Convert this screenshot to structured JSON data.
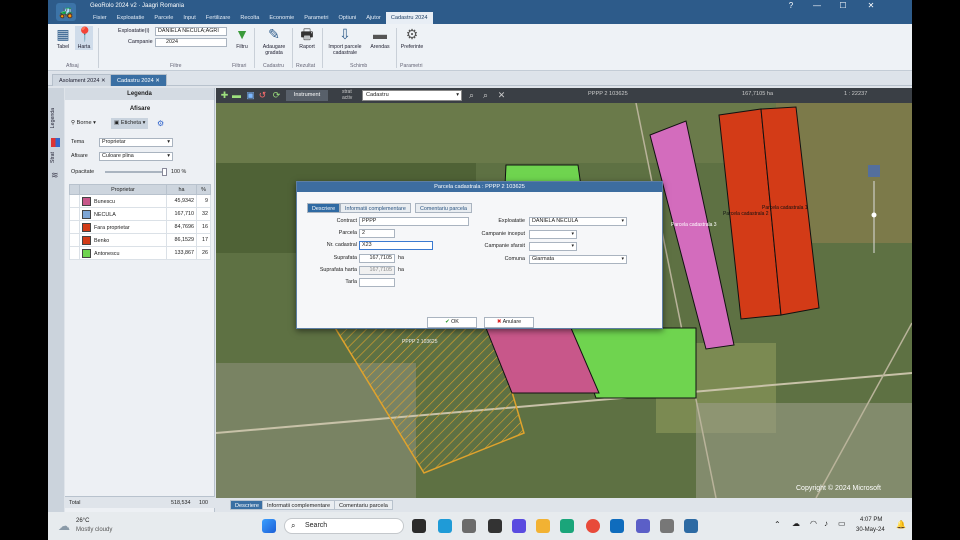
{
  "app": {
    "title": "GeoRolo 2024 v2 · Jaagri Romania",
    "menu": [
      "Fisier",
      "Exploatatie",
      "Parcele",
      "Input",
      "Fertilizare",
      "Recolta",
      "Economie",
      "Parametri",
      "Optiuni",
      "Ajutor",
      "Cadastru 2024"
    ],
    "window_controls": {
      "help": "?",
      "min": "—",
      "max": "☐",
      "close": "✕"
    }
  },
  "ribbon": {
    "tabel_label": "Tabel",
    "harta_label": "Harta",
    "afisaj_label": "Afisaj",
    "exploatatie_label": "Exploatatie(i)",
    "exploatatie_value": "DANIELA NECULA;AGRI",
    "campanie_label": "Campanie",
    "campanie_value": "2024",
    "filtre_label": "Filtre",
    "filtru_label": "Filtru",
    "filtrari_label": "Filtrari",
    "adaugare_label": "Adaugare gradata",
    "cadastru_label": "Cadastru",
    "raport_label": "Raport",
    "rezultat_label": "Rezultat",
    "import_label": "Import parcele cadastrale",
    "arendas_label": "Arendas",
    "schimb_label": "Schimb",
    "preferinte_label": "Preferinte",
    "parametri_label": "Parametri"
  },
  "doc_tabs": [
    {
      "label": "Asolament 2024"
    },
    {
      "label": "Cadastru 2024"
    }
  ],
  "left_strip": {
    "legenda": "Legenda",
    "strat": "Strat"
  },
  "legend_panel": {
    "title": "Legenda",
    "afisare": "Afisare",
    "borne": "Borne",
    "eticheta": "Eticheta",
    "tema_label": "Tema",
    "tema_value": "Proprietar",
    "afisare_label": "Afisare",
    "afisare_value": "Culoare plina",
    "opacitate_label": "Opacitate",
    "opacitate_value": "100 %",
    "col_proprietar": "Proprietar",
    "col_ha": "ha",
    "col_pct": "%",
    "rows": [
      {
        "name": "Bunescu",
        "ha": "45,9342",
        "pct": "9",
        "color": "#c8578a"
      },
      {
        "name": "NECULA",
        "ha": "167,710",
        "pct": "32",
        "color": "#7ea6d6"
      },
      {
        "name": "Fara proprietar",
        "ha": "84,7696",
        "pct": "16",
        "color": "#d33b17"
      },
      {
        "name": "Benko",
        "ha": "86,1529",
        "pct": "17",
        "color": "#d33b17"
      },
      {
        "name": "Antonescu",
        "ha": "133,867",
        "pct": "26",
        "color": "#6fd44f"
      }
    ],
    "total_label": "Total",
    "total_ha": "518,534",
    "total_pct": "100"
  },
  "map_toolbar": {
    "strat_label": "strat activ",
    "strat_value": "Cadastru",
    "instrument": "Instrument",
    "parcel_info": "PPPP 2 103625",
    "area_info": "167,7105 ha",
    "scale": "1 : 22237"
  },
  "map": {
    "labels": [
      "Parcela cadastrala 1",
      "Parcela cadastrala 2",
      "Parcela cadastrala 3",
      "PPPP 2 103625"
    ],
    "copyright": "Copyright © 2024 Microsoft"
  },
  "dialog": {
    "title": "Parcela cadastrala : PPPP 2 103625",
    "tabs": [
      "Descriere",
      "Informatii complementare",
      "Comentariu parcela"
    ],
    "contract_label": "Contract",
    "contract_value": "PPPP",
    "parcela_label": "Parcela",
    "parcela_value": "2",
    "nrcad_label": "Nr. cadastral",
    "nrcad_value": "X23",
    "suprafata_label": "Suprafata",
    "suprafata_value": "167,7105",
    "suprafata_harta_label": "Suprafata harta",
    "suprafata_harta_value": "167,7105",
    "tarla_label": "Tarla",
    "tarla_value": "",
    "unit": "ha",
    "exploatatie_label": "Exploatatie",
    "exploatatie_value": "DANIELA NECULA",
    "campanie_inceput_label": "Campanie inceput",
    "campanie_sfarsit_label": "Campanie sfarsit",
    "comuna_label": "Comuna",
    "comuna_value": "Giarmata",
    "ok_label": "OK",
    "anulare_label": "Anulare"
  },
  "bottom_tabs": [
    "Descriere",
    "Informatii complementare",
    "Comentariu parcela"
  ],
  "taskbar": {
    "weather_temp": "26°C",
    "weather_desc": "Mostly cloudy",
    "search_placeholder": "Search",
    "time": "4:07 PM",
    "date": "30-May-24"
  }
}
